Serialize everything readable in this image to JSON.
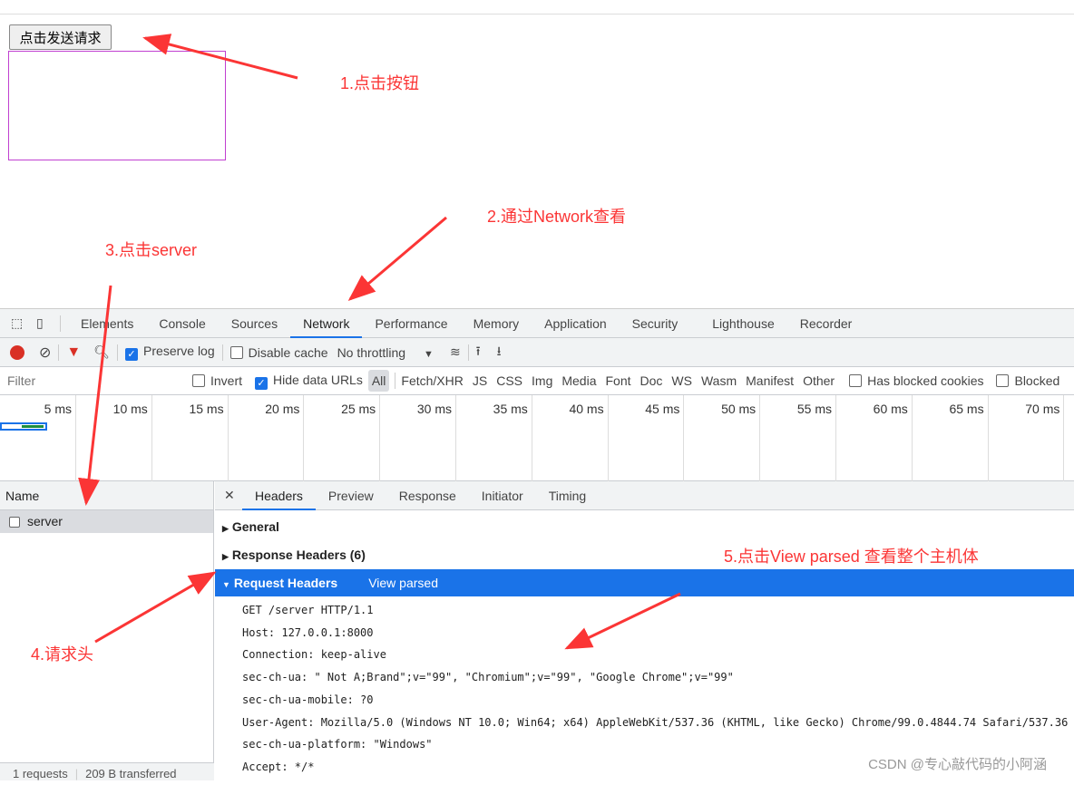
{
  "page": {
    "button": "点击发送请求"
  },
  "annotations": [
    "1.点击按钮",
    "2.通过Network查看",
    "3.点击server",
    "4.请求头",
    "5.点击View parsed 查看整个主机体"
  ],
  "devtools": {
    "tabs": [
      "Elements",
      "Console",
      "Sources",
      "Network",
      "Performance",
      "Memory",
      "Application",
      "Security",
      "Lighthouse",
      "Recorder"
    ],
    "active_tab": "Network",
    "toolbar": {
      "preserve_log": "Preserve log",
      "disable_cache": "Disable cache",
      "throttling": "No throttling"
    },
    "filter": {
      "placeholder": "Filter",
      "invert": "Invert",
      "hide_data_urls": "Hide data URLs",
      "types": [
        "All",
        "Fetch/XHR",
        "JS",
        "CSS",
        "Img",
        "Media",
        "Font",
        "Doc",
        "WS",
        "Wasm",
        "Manifest",
        "Other"
      ],
      "has_blocked_cookies": "Has blocked cookies",
      "blocked": "Blocked"
    },
    "timeline": [
      "5 ms",
      "10 ms",
      "15 ms",
      "20 ms",
      "25 ms",
      "30 ms",
      "35 ms",
      "40 ms",
      "45 ms",
      "50 ms",
      "55 ms",
      "60 ms",
      "65 ms",
      "70 ms"
    ],
    "name_header": "Name",
    "request": "server",
    "status": {
      "requests": "1 requests",
      "transferred": "209 B transferred"
    },
    "detail_tabs": [
      "Headers",
      "Preview",
      "Response",
      "Initiator",
      "Timing"
    ],
    "general": "General",
    "response_headers": "Response Headers (6)",
    "request_headers": "Request Headers",
    "view_parsed": "View parsed",
    "header_lines": [
      "GET /server HTTP/1.1",
      "Host: 127.0.0.1:8000",
      "Connection: keep-alive",
      "sec-ch-ua: \" Not A;Brand\";v=\"99\", \"Chromium\";v=\"99\", \"Google Chrome\";v=\"99\"",
      "sec-ch-ua-mobile: ?0",
      "User-Agent: Mozilla/5.0 (Windows NT 10.0; Win64; x64) AppleWebKit/537.36 (KHTML, like Gecko) Chrome/99.0.4844.74 Safari/537.36",
      "sec-ch-ua-platform: \"Windows\"",
      "Accept: */*"
    ]
  },
  "watermark": "CSDN @专心敲代码的小阿涵",
  "colors": {
    "accent": "#1a73e8",
    "annotation": "#fb3535",
    "record": "#d93025"
  }
}
